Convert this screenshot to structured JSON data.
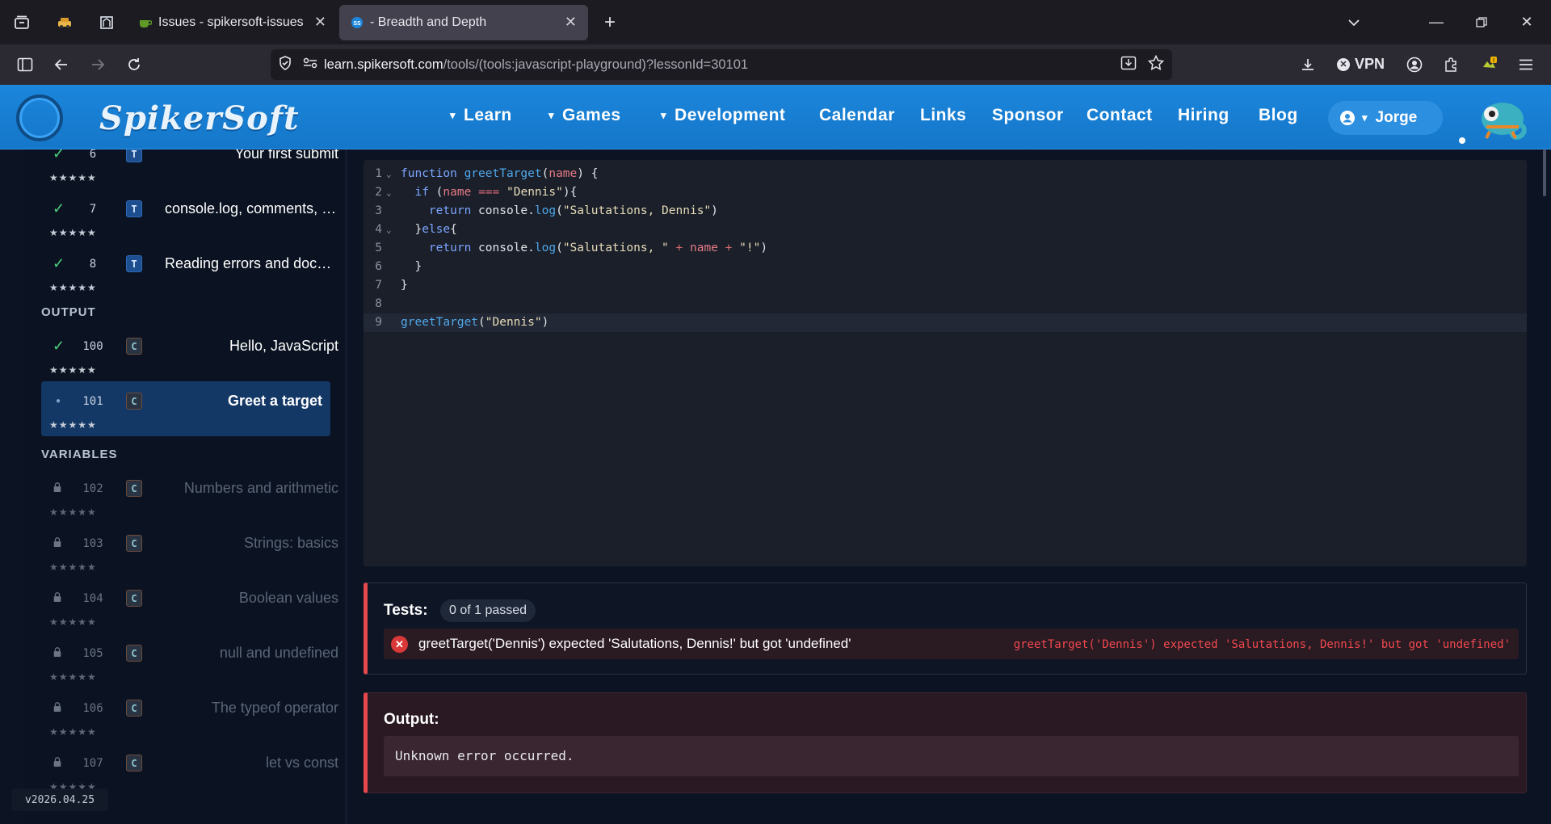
{
  "browser": {
    "tabs": [
      {
        "title": "Issues - spikersoft-issues - Gitea",
        "active": false
      },
      {
        "title": "- Breadth and Depth",
        "active": true
      }
    ],
    "url_domain": "learn.spikersoft.com",
    "url_path": "/tools/(tools:javascript-playground)?lessonId=30101",
    "url_prefix": "",
    "vpn_label": "VPN"
  },
  "site": {
    "logo_text": "SpikerSoft",
    "nav": [
      {
        "label": "Learn",
        "dropdown": true
      },
      {
        "label": "Games",
        "dropdown": true
      },
      {
        "label": "Development",
        "dropdown": true
      },
      {
        "label": "Calendar",
        "dropdown": false
      },
      {
        "label": "Links",
        "dropdown": false
      },
      {
        "label": "Sponsor",
        "dropdown": false
      },
      {
        "label": "Contact",
        "dropdown": false
      },
      {
        "label": "Hiring",
        "dropdown": false
      },
      {
        "label": "Blog",
        "dropdown": false
      }
    ],
    "user_name": "Jorge"
  },
  "sidebar": {
    "stars": "★★★★★",
    "lessons_intro": [
      {
        "num": "6",
        "type": "T",
        "title": "Your first submit",
        "status": "done"
      },
      {
        "num": "7",
        "type": "T",
        "title": "console.log, comments, and basic syntax",
        "status": "done"
      },
      {
        "num": "8",
        "type": "T",
        "title": "Reading errors and documentation",
        "status": "done"
      }
    ],
    "section_output": "OUTPUT",
    "lessons_output": [
      {
        "num": "100",
        "type": "C",
        "title": "Hello, JavaScript",
        "status": "done"
      },
      {
        "num": "101",
        "type": "C",
        "title": "Greet a target",
        "status": "current"
      }
    ],
    "section_variables": "VARIABLES",
    "lessons_variables": [
      {
        "num": "102",
        "type": "C",
        "title": "Numbers and arithmetic",
        "status": "locked"
      },
      {
        "num": "103",
        "type": "C",
        "title": "Strings: basics",
        "status": "locked"
      },
      {
        "num": "104",
        "type": "C",
        "title": "Boolean values",
        "status": "locked"
      },
      {
        "num": "105",
        "type": "C",
        "title": "null and undefined",
        "status": "locked"
      },
      {
        "num": "106",
        "type": "C",
        "title": "The typeof operator",
        "status": "locked"
      },
      {
        "num": "107",
        "type": "C",
        "title": "let vs const",
        "status": "locked"
      }
    ],
    "version": "v2026.04.25"
  },
  "editor": {
    "current_line": 9,
    "lines": [
      "function greetTarget(name) {",
      "  if (name === \"Dennis\"){",
      "    return console.log(\"Salutations, Dennis\")",
      "  }else{",
      "    return console.log(\"Salutations, \" + name + \"!\")",
      "  }",
      "}",
      "",
      "greetTarget(\"Dennis\")"
    ]
  },
  "tests": {
    "label": "Tests:",
    "count": "0 of 1 passed",
    "result_message": "greetTarget('Dennis') expected 'Salutations, Dennis!' but got 'undefined'",
    "result_detail": "greetTarget('Dennis') expected 'Salutations, Dennis!' but got 'undefined'"
  },
  "output": {
    "label": "Output:",
    "text": "Unknown error occurred."
  },
  "colors": {
    "header_blue": "#1b86dc",
    "error_red": "#e5484d",
    "done_green": "#4cd07a"
  }
}
